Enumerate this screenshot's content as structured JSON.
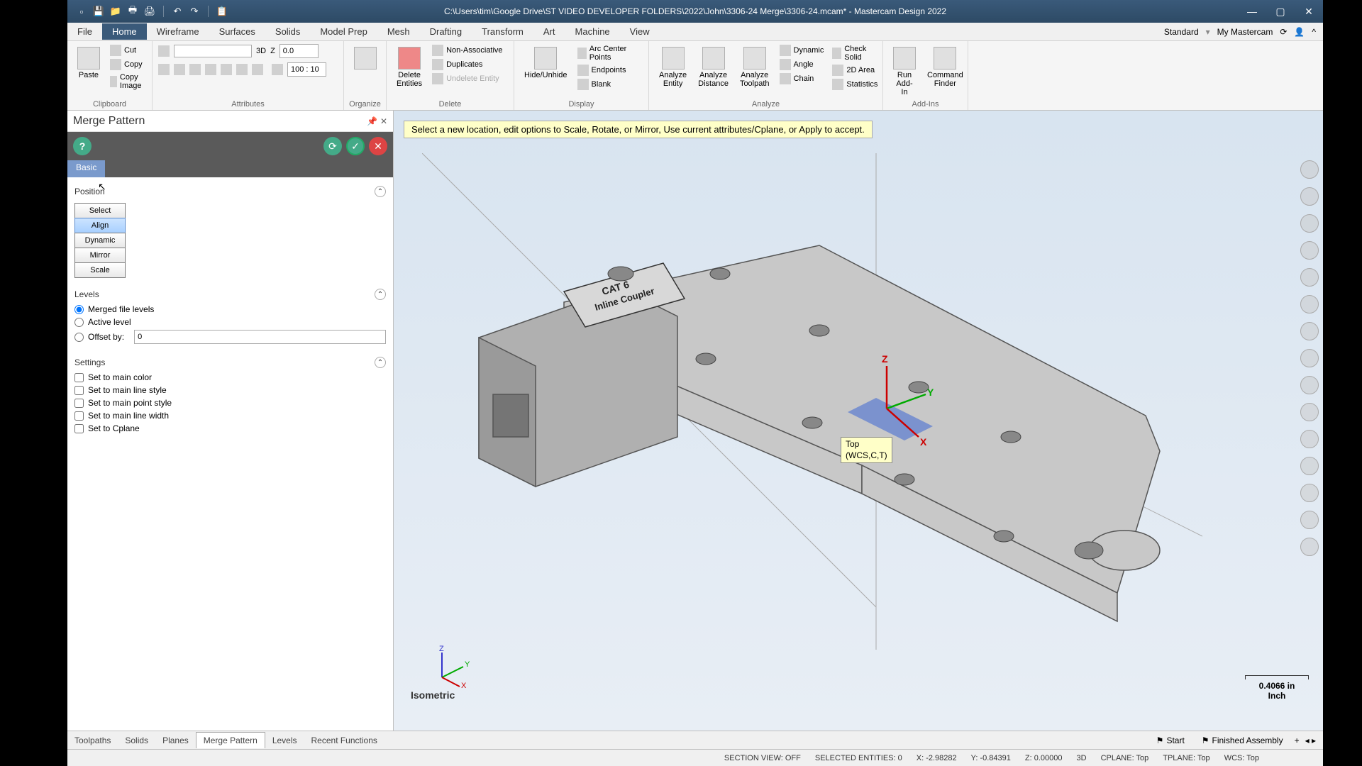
{
  "title": "C:\\Users\\tim\\Google Drive\\ST VIDEO DEVELOPER FOLDERS\\2022\\John\\3306-24 Merge\\3306-24.mcam* - Mastercam Design 2022",
  "menu_right": {
    "standard": "Standard",
    "my_mastercam": "My Mastercam"
  },
  "tabs": [
    "File",
    "Home",
    "Wireframe",
    "Surfaces",
    "Solids",
    "Model Prep",
    "Mesh",
    "Drafting",
    "Transform",
    "Art",
    "Machine",
    "View"
  ],
  "ribbon": {
    "clipboard": {
      "label": "Clipboard",
      "paste": "Paste",
      "cut": "Cut",
      "copy": "Copy",
      "copy_image": "Copy Image"
    },
    "attributes": {
      "label": "Attributes",
      "mode": "3D",
      "z_label": "Z",
      "z_value": "0.0",
      "zoom": "100 : 10"
    },
    "organize": {
      "label": "Organize"
    },
    "delete": {
      "label": "Delete",
      "delete_entities": "Delete\nEntities",
      "non_assoc": "Non-Associative",
      "duplicates": "Duplicates",
      "undelete": "Undelete Entity"
    },
    "display": {
      "label": "Display",
      "hide_unhide": "Hide/Unhide",
      "arc_center": "Arc Center Points",
      "endpoints": "Endpoints",
      "blank": "Blank"
    },
    "analyze": {
      "label": "Analyze",
      "entity": "Analyze\nEntity",
      "distance": "Analyze\nDistance",
      "toolpath": "Analyze\nToolpath",
      "dynamic": "Dynamic",
      "angle": "Angle",
      "chain": "Chain",
      "check_solid": "Check Solid",
      "2d_area": "2D Area",
      "statistics": "Statistics"
    },
    "addins": {
      "label": "Add-Ins",
      "run": "Run\nAdd-In",
      "finder": "Command\nFinder"
    }
  },
  "panel": {
    "title": "Merge Pattern",
    "tab": "Basic",
    "position": {
      "header": "Position",
      "select": "Select",
      "align": "Align",
      "dynamic": "Dynamic",
      "mirror": "Mirror",
      "scale": "Scale"
    },
    "levels": {
      "header": "Levels",
      "merged": "Merged file levels",
      "active": "Active level",
      "offset": "Offset by:",
      "offset_value": "0"
    },
    "settings": {
      "header": "Settings",
      "main_color": "Set to main color",
      "main_line_style": "Set to main line style",
      "main_point_style": "Set to main point style",
      "main_line_width": "Set to main line width",
      "cplane": "Set to Cplane"
    }
  },
  "viewport": {
    "hint": "Select a new location, edit options to Scale, Rotate, or Mirror, Use current attributes/Cplane, or Apply to accept.",
    "wcs_line1": "Top",
    "wcs_line2": "(WCS,C,T)",
    "view_name": "Isometric",
    "scale_value": "0.4066 in",
    "scale_unit": "Inch",
    "part_text1": "CAT 6",
    "part_text2": "Inline Coupler",
    "axis_x": "X",
    "axis_y": "Y",
    "axis_z": "Z"
  },
  "bottom_tabs": [
    "Toolpaths",
    "Solids",
    "Planes",
    "Merge Pattern",
    "Levels",
    "Recent Functions"
  ],
  "bottom_right": {
    "start": "Start",
    "finished": "Finished Assembly",
    "plus": "+"
  },
  "status": {
    "section": "SECTION VIEW: OFF",
    "selected": "SELECTED ENTITIES: 0",
    "x": "X: -2.98282",
    "y": "Y: -0.84391",
    "z": "Z: 0.00000",
    "mode": "3D",
    "cplane": "CPLANE: Top",
    "tplane": "TPLANE: Top",
    "wcs": "WCS: Top"
  }
}
